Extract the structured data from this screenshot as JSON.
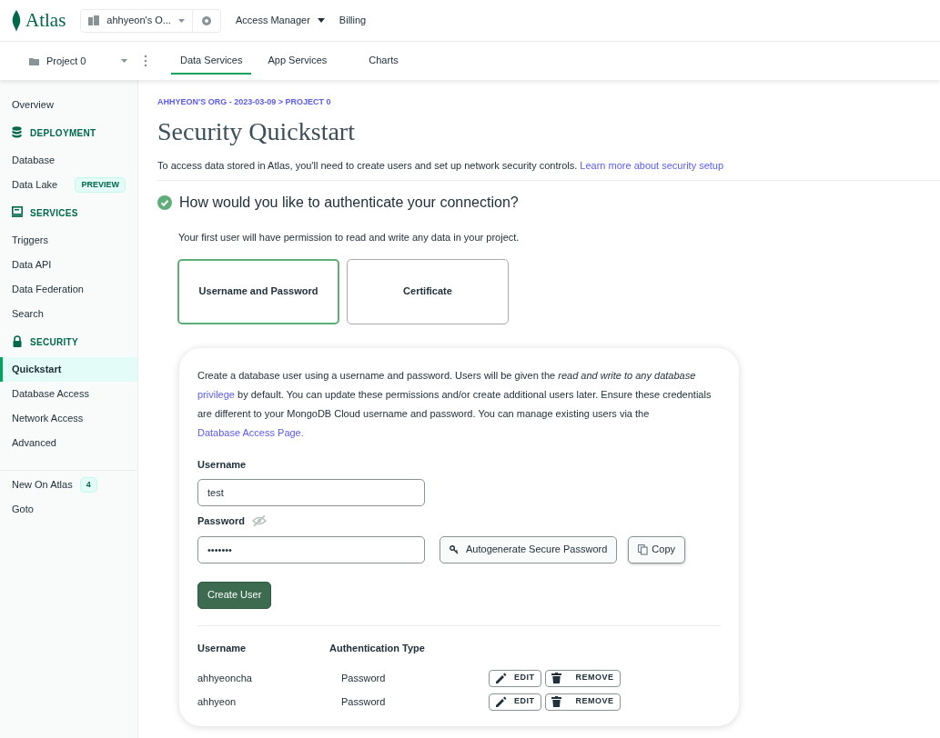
{
  "header": {
    "logo_text": "Atlas",
    "org_selector": "ahhyeon's O...",
    "nav": [
      {
        "label": "Access Manager",
        "dropdown": true
      },
      {
        "label": "Billing",
        "dropdown": false
      }
    ]
  },
  "project_bar": {
    "project": "Project 0",
    "tabs": [
      {
        "label": "Data Services",
        "selected": true
      },
      {
        "label": "App Services",
        "selected": false
      },
      {
        "label": "Charts",
        "selected": false
      }
    ]
  },
  "sidebar": {
    "top_items": [
      {
        "label": "Overview",
        "selected": false
      }
    ],
    "sections": [
      {
        "kind": "database",
        "title": "DEPLOYMENT",
        "items": [
          {
            "label": "Database",
            "selected": false
          },
          {
            "label": "Data Lake",
            "badge": "PREVIEW",
            "selected": false
          }
        ]
      },
      {
        "kind": "screen",
        "title": "SERVICES",
        "items": [
          {
            "label": "Triggers",
            "selected": false
          },
          {
            "label": "Data API",
            "selected": false
          },
          {
            "label": "Data Federation",
            "selected": false
          },
          {
            "label": "Search",
            "selected": false
          }
        ]
      },
      {
        "kind": "lock",
        "title": "SECURITY",
        "items": [
          {
            "label": "Quickstart",
            "selected": true
          },
          {
            "label": "Database Access",
            "selected": false
          },
          {
            "label": "Network Access",
            "selected": false
          },
          {
            "label": "Advanced",
            "selected": false
          }
        ]
      }
    ],
    "footer_items": [
      {
        "label": "New On Atlas",
        "badge": "4"
      },
      {
        "label": "Goto"
      }
    ]
  },
  "main": {
    "breadcrumb": "AHHYEON'S ORG - 2023-03-09 > PROJECT 0",
    "title": "Security Quickstart",
    "intro": {
      "text": "To access data stored in Atlas, you'll need to create users and set up network security controls.",
      "link": "Learn more about security setup"
    },
    "step": {
      "title": "How would you like to authenticate your connection?",
      "completed": true
    },
    "step_note": "Your first user will have permission to read and write any data in your project.",
    "auth_options": [
      {
        "label": "Username and Password",
        "selected": true
      },
      {
        "label": "Certificate",
        "selected": false
      }
    ],
    "card": {
      "description": [
        {
          "kind": "text",
          "text": "Create a database user using a username and password. Users will be given the *read and write to any database* "
        },
        {
          "kind": "link",
          "text": "privilege"
        },
        {
          "kind": "text",
          "text": " by default. You can update these permissions and/or create additional users later. Ensure these credentials are different to your MongoDB Cloud username and password. You can manage existing users via the "
        },
        {
          "kind": "link",
          "text": "Database Access Page."
        }
      ],
      "username": {
        "label": "Username",
        "value": "test"
      },
      "password": {
        "label": "Password",
        "value": "•••••••",
        "hidden": true
      },
      "autogenerate_button": "Autogenerate Secure Password",
      "copy_button": "Copy",
      "create_button": "Create User",
      "table": {
        "columns": [
          "Username",
          "Authentication Type"
        ],
        "rows": [
          {
            "username": "ahhyeoncha",
            "auth_type": "Password",
            "actions": [
              "EDIT",
              "REMOVE"
            ]
          },
          {
            "username": "ahhyeon",
            "auth_type": "Password",
            "actions": [
              "EDIT",
              "REMOVE"
            ]
          }
        ]
      }
    }
  }
}
